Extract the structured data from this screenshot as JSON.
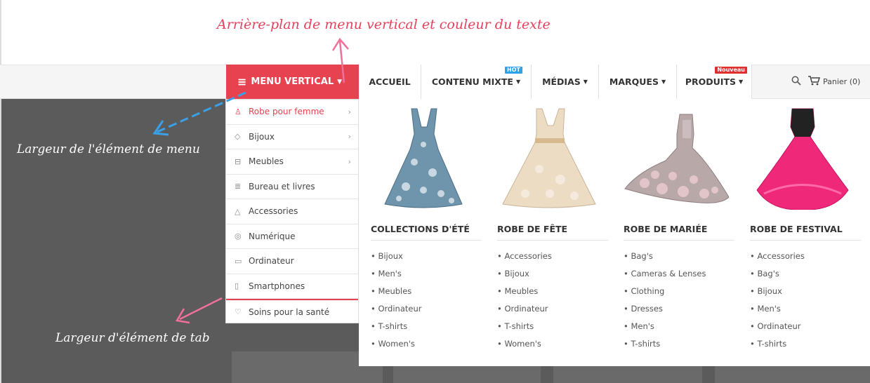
{
  "annotations": {
    "top": "Arrière-plan de menu vertical et couleur du texte",
    "menu_width": "Largeur de l'élément de menu",
    "tab_width": "Largeur d'élément de tab"
  },
  "navbar": {
    "vertical_label": "MENU VERTICAL",
    "items": [
      {
        "label": "ACCUEIL",
        "caret": false
      },
      {
        "label": "CONTENU MIXTE",
        "caret": true,
        "badge": "HOT"
      },
      {
        "label": "MÉDIAS",
        "caret": true
      },
      {
        "label": "MARQUES",
        "caret": true
      },
      {
        "label": "PRODUITS",
        "caret": true,
        "badge": "Nouveau"
      }
    ],
    "cart_label": "Panier (0)"
  },
  "vertical_menu": {
    "items": [
      {
        "label": "Robe pour femme",
        "icon": "dress-icon",
        "submenu": true,
        "active": true
      },
      {
        "label": "Bijoux",
        "icon": "diamond-icon",
        "submenu": true
      },
      {
        "label": "Meubles",
        "icon": "sofa-icon",
        "submenu": true
      },
      {
        "label": "Bureau et livres",
        "icon": "books-icon",
        "submenu": false
      },
      {
        "label": "Accessories",
        "icon": "hanger-icon",
        "submenu": false
      },
      {
        "label": "Numérique",
        "icon": "camera-icon",
        "submenu": false
      },
      {
        "label": "Ordinateur",
        "icon": "monitor-icon",
        "submenu": false
      },
      {
        "label": "Smartphones",
        "icon": "phone-icon",
        "submenu": false
      },
      {
        "label": "Soins pour la santé",
        "icon": "health-icon",
        "submenu": false
      }
    ]
  },
  "mega": {
    "columns": [
      {
        "title": "COLLECTIONS D'ÉTÉ",
        "dress_color": "#6f95ad",
        "items": [
          "Bijoux",
          "Men's",
          "Meubles",
          "Ordinateur",
          "T-shirts",
          "Women's"
        ]
      },
      {
        "title": "ROBE DE FÊTE",
        "dress_color": "#ecdcc4",
        "items": [
          "Accessories",
          "Bijoux",
          "Meubles",
          "Ordinateur",
          "T-shirts",
          "Women's"
        ]
      },
      {
        "title": "ROBE DE MARIÉE",
        "dress_color": "#b9a8a8",
        "items": [
          "Bag's",
          "Cameras & Lenses",
          "Clothing",
          "Dresses",
          "Men's",
          "T-shirts"
        ]
      },
      {
        "title": "ROBE DE FESTIVAL",
        "dress_color": "#f0287a",
        "items": [
          "Accessories",
          "Bag's",
          "Bijoux",
          "Men's",
          "Ordinateur",
          "T-shirts"
        ]
      }
    ]
  },
  "colors": {
    "accent": "#e6424f",
    "annotation": "#e4415d",
    "arrow_blue": "#3aa0e8",
    "arrow_pink": "#f0709a"
  }
}
